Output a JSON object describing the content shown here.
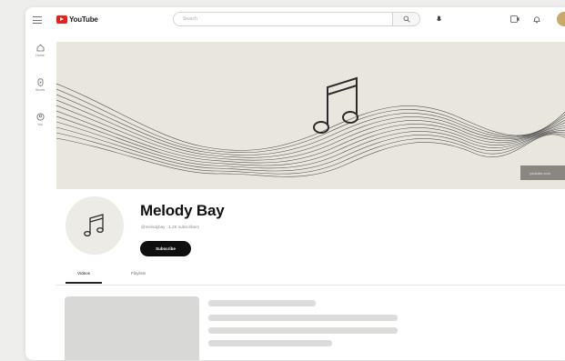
{
  "header": {
    "logo_text": "YouTube",
    "search_placeholder": "Search"
  },
  "sidebar": {
    "items": [
      {
        "label": "Home",
        "icon": "home-icon"
      },
      {
        "label": "Shorts",
        "icon": "shorts-icon"
      },
      {
        "label": "You",
        "icon": "user-icon"
      }
    ]
  },
  "banner": {
    "links_label": "youtube.com"
  },
  "channel": {
    "name": "Melody Bay",
    "meta": "@melodybay · 1.2K subscribers",
    "subscribe_label": "Subscribe"
  },
  "tabs": [
    {
      "label": "Videos",
      "active": true
    },
    {
      "label": "Playlists",
      "active": false
    }
  ],
  "colors": {
    "brand_red": "#e62117",
    "banner_bg": "#e9e6de"
  }
}
